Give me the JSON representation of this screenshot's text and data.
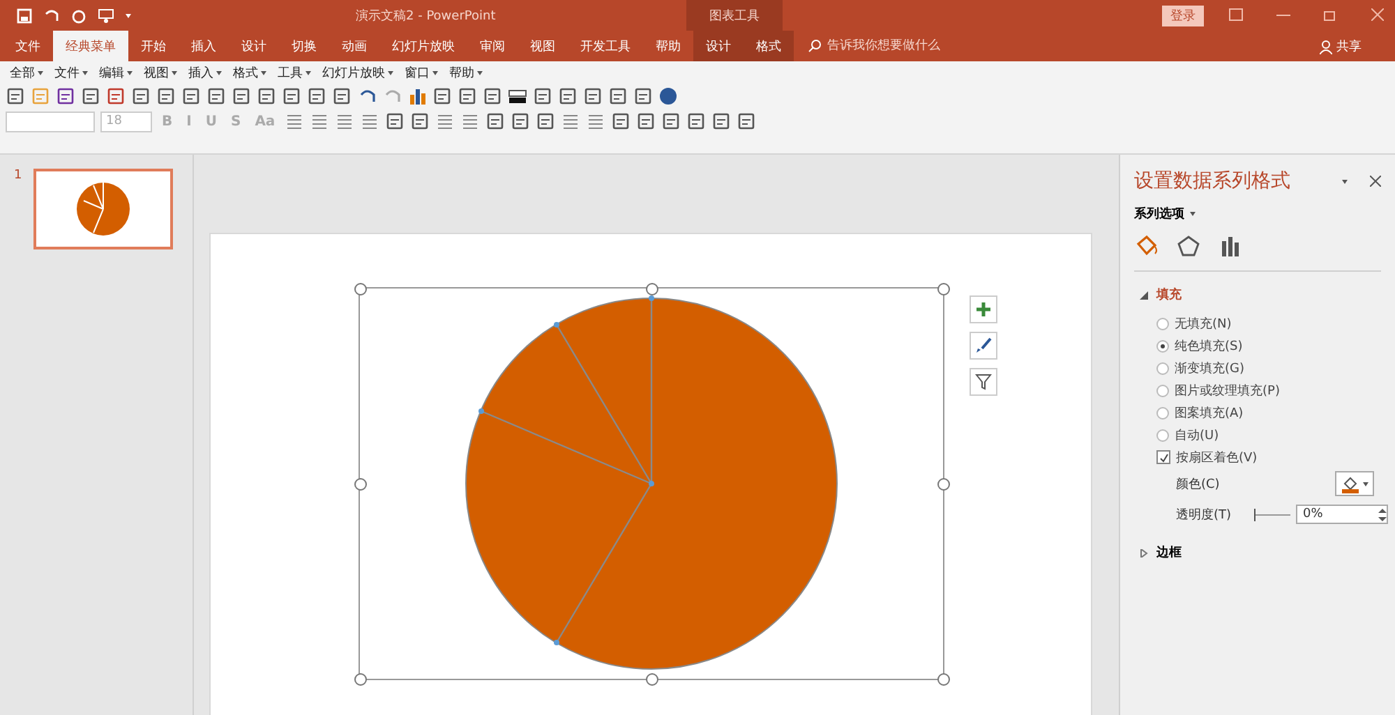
{
  "window": {
    "title": "演示文稿2 - PowerPoint",
    "contextual_group": "图表工具",
    "login_button": "登录"
  },
  "ribbon_tabs": [
    {
      "label": "文件",
      "selected": false,
      "kind": "main"
    },
    {
      "label": "经典菜单",
      "selected": true,
      "kind": "main"
    },
    {
      "label": "开始",
      "selected": false,
      "kind": "main"
    },
    {
      "label": "插入",
      "selected": false,
      "kind": "main"
    },
    {
      "label": "设计",
      "selected": false,
      "kind": "main"
    },
    {
      "label": "切换",
      "selected": false,
      "kind": "main"
    },
    {
      "label": "动画",
      "selected": false,
      "kind": "main"
    },
    {
      "label": "幻灯片放映",
      "selected": false,
      "kind": "main"
    },
    {
      "label": "审阅",
      "selected": false,
      "kind": "main"
    },
    {
      "label": "视图",
      "selected": false,
      "kind": "main"
    },
    {
      "label": "开发工具",
      "selected": false,
      "kind": "main"
    },
    {
      "label": "帮助",
      "selected": false,
      "kind": "main"
    },
    {
      "label": "设计",
      "selected": false,
      "kind": "contextual"
    },
    {
      "label": "格式",
      "selected": false,
      "kind": "contextual"
    }
  ],
  "search": {
    "placeholder": "告诉我你想要做什么"
  },
  "share_button": "共享",
  "classic_menu": [
    "全部",
    "文件",
    "编辑",
    "视图",
    "插入",
    "格式",
    "工具",
    "幻灯片放映",
    "窗口",
    "帮助"
  ],
  "format_bar": {
    "disabled": true,
    "font_size": "18",
    "buttons": [
      "B",
      "I",
      "U",
      "S",
      "Aa"
    ]
  },
  "slides": [
    {
      "number": "1",
      "selected": true
    }
  ],
  "pane": {
    "title": "设置数据系列格式",
    "series_dropdown": "系列选项",
    "icon_tabs": [
      {
        "selected": true
      },
      {
        "selected": false
      },
      {
        "selected": false
      }
    ],
    "sections": [
      {
        "label": "填充",
        "expanded": true,
        "options": [
          {
            "kind": "radio",
            "label": "无填充(N)",
            "selected": false
          },
          {
            "kind": "radio",
            "label": "纯色填充(S)",
            "selected": true
          },
          {
            "kind": "radio",
            "label": "渐变填充(G)",
            "selected": false
          },
          {
            "kind": "radio",
            "label": "图片或纹理填充(P)",
            "selected": false
          },
          {
            "kind": "radio",
            "label": "图案填充(A)",
            "selected": false
          },
          {
            "kind": "radio",
            "label": "自动(U)",
            "selected": false
          },
          {
            "kind": "checkbox",
            "label": "按扇区着色(V)",
            "checked": true
          }
        ],
        "color_label": "颜色(C)",
        "transparency": {
          "label": "透明度(T)",
          "level": 0,
          "value": "0%"
        }
      },
      {
        "label": "边框",
        "expanded": false
      }
    ]
  }
}
